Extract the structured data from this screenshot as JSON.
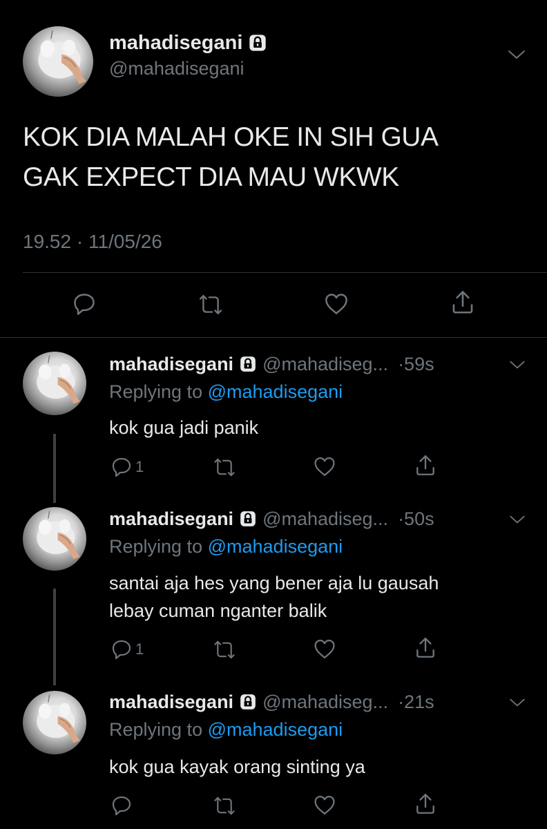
{
  "main_tweet": {
    "display_name": "mahadisegani",
    "handle": "@mahadisegani",
    "text_line1": "KOK DIA MALAH OKE IN SIH GUA",
    "text_line2": "GAK EXPECT DIA MAU WKWK",
    "timestamp": "19.52 · 11/05/26"
  },
  "replies": [
    {
      "display_name": "mahadisegani",
      "handle": "@mahadiseg...",
      "time": "·59s",
      "replying_prefix": "Replying to",
      "replying_to": "@mahadisegani",
      "text_line1": "kok gua jadi panik",
      "text_line2": "",
      "reply_count": "1"
    },
    {
      "display_name": "mahadisegani",
      "handle": "@mahadiseg...",
      "time": "·50s",
      "replying_prefix": "Replying to",
      "replying_to": "@mahadisegani",
      "text_line1": "santai aja hes yang bener aja lu gausah",
      "text_line2": "lebay cuman nganter balik",
      "reply_count": "1"
    },
    {
      "display_name": "mahadisegani",
      "handle": "@mahadiseg...",
      "time": "·21s",
      "replying_prefix": "Replying to",
      "replying_to": "@mahadisegani",
      "text_line1": "kok gua kayak orang sinting ya",
      "text_line2": "",
      "reply_count": ""
    }
  ],
  "icons": [
    "lock-icon",
    "chevron-down-icon",
    "reply-icon",
    "retweet-icon",
    "like-icon",
    "share-icon"
  ],
  "colors": {
    "background": "#000000",
    "text": "#e7e9ea",
    "muted": "#6e767d",
    "link": "#1d9bf0",
    "divider": "#2f3336"
  }
}
